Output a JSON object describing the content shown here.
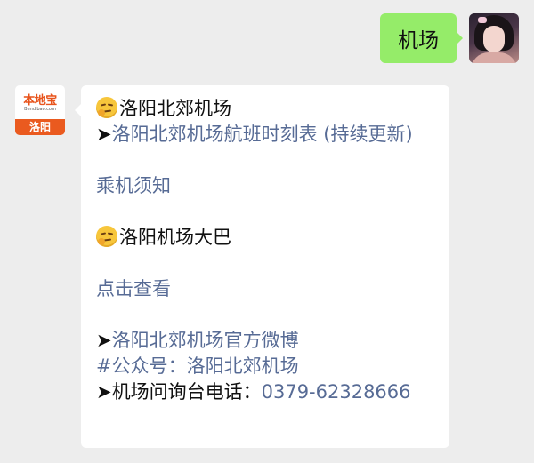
{
  "conversation": {
    "outgoing": {
      "text": "机场"
    },
    "incoming": {
      "avatar": {
        "logo_text": "本地宝",
        "logo_sub": "Bendibao.com",
        "city": "洛阳"
      },
      "lines": {
        "heading1": "洛阳北郊机场",
        "schedule_arrow": "➤",
        "schedule_link": "洛阳北郊机场航班时刻表 (持续更新)",
        "notice_link": "乘机须知",
        "heading2": "洛阳机场大巴",
        "view_link": "点击查看",
        "weibo_arrow": "➤",
        "weibo_link": "洛阳北郊机场官方微博",
        "hashtag_prefix": "#公众号：",
        "hashtag_link": "洛阳北郊机场",
        "phone_arrow": "➤",
        "phone_label": "机场问询台电话：",
        "phone_number": "0379-62328666"
      },
      "icons": {
        "heading_emoji": "thinking-face-icon"
      }
    }
  }
}
